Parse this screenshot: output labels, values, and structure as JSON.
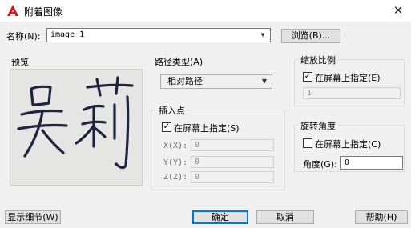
{
  "window": {
    "title": "附着图像",
    "close": "✕"
  },
  "name": {
    "label": "名称(N):",
    "value": "image 1",
    "browse_label": "浏览(B)..."
  },
  "preview": {
    "label": "预览",
    "signature": "吴莉"
  },
  "path_type": {
    "label": "路径类型(A)",
    "value": "相对路径"
  },
  "insertion": {
    "label": "插入点",
    "specify_on_screen": "在屏幕上指定(S)",
    "specify_checked": true,
    "x_label": "X(X):",
    "x_value": "0",
    "y_label": "Y(Y):",
    "y_value": "0",
    "z_label": "Z(Z):",
    "z_value": "0"
  },
  "scale": {
    "label": "缩放比例",
    "specify_on_screen": "在屏幕上指定(E)",
    "specify_checked": true,
    "value": "1"
  },
  "rotation": {
    "label": "旋转角度",
    "specify_on_screen": "在屏幕上指定(C)",
    "specify_checked": false,
    "angle_label": "角度(G):",
    "angle_value": "0"
  },
  "buttons": {
    "details": "显示细节(W)",
    "ok": "确定",
    "cancel": "取消",
    "help": "帮助(H)"
  },
  "colors": {
    "accent": "#0078d7",
    "logo_red": "#d4131b",
    "ink": "#1f2340"
  }
}
